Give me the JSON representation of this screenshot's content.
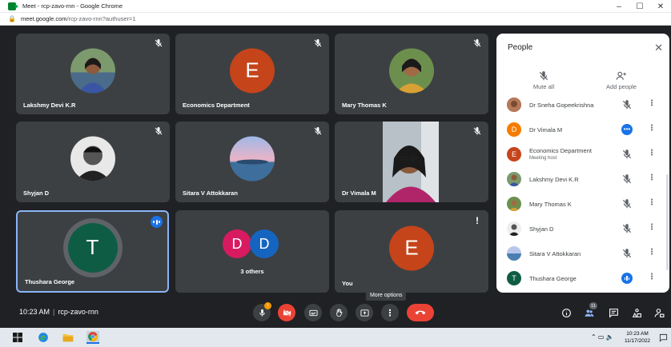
{
  "browser": {
    "window_title": "Meet - rcp-zavo-rnn - Google Chrome",
    "url_host": "meet.google.com",
    "url_path": "/rcp-zavo-rnn?authuser=1",
    "controls": [
      "–",
      "☐",
      "✕"
    ]
  },
  "tiles": [
    {
      "name": "Lakshmy Devi K.R",
      "type": "photo",
      "muted": true
    },
    {
      "name": "Economics Department",
      "type": "letter",
      "letter": "E",
      "color": "#c5441a",
      "muted": true
    },
    {
      "name": "Mary Thomas K",
      "type": "photo",
      "muted": true
    },
    {
      "name": "Shyjan D",
      "type": "photo",
      "muted": true
    },
    {
      "name": "Sitara V Attokkaran",
      "type": "photo",
      "muted": true
    },
    {
      "name": "Dr Vimala M",
      "type": "video",
      "muted": true
    },
    {
      "name": "Thushara George",
      "type": "letter",
      "letter": "T",
      "color": "#0f5c45",
      "speaking": true
    },
    {
      "name": "3 others",
      "type": "group",
      "letters": [
        "D",
        "D"
      ],
      "colors": [
        "#d81b60",
        "#1565c0"
      ]
    },
    {
      "name": "You",
      "type": "letter",
      "letter": "E",
      "color": "#c5441a",
      "warning": "!"
    }
  ],
  "people_panel": {
    "title": "People",
    "mute_all": "Mute all",
    "add_people": "Add people",
    "participants": [
      {
        "name": "Dr Sneha Gopeekrishna",
        "avatar": "photo",
        "status": "muted"
      },
      {
        "name": "Dr Vimala M",
        "avatar": "letter",
        "letter": "D",
        "color": "#f57c00",
        "status": "more"
      },
      {
        "name": "Economics Department",
        "sub": "Meeting host",
        "avatar": "letter",
        "letter": "E",
        "color": "#c5441a",
        "status": "muted"
      },
      {
        "name": "Lakshmy Devi K.R",
        "avatar": "photo",
        "status": "muted"
      },
      {
        "name": "Mary Thomas K",
        "avatar": "photo",
        "status": "muted"
      },
      {
        "name": "Shyjan D",
        "avatar": "photo",
        "status": "muted"
      },
      {
        "name": "Sitara V Attokkaran",
        "avatar": "photo",
        "status": "muted"
      },
      {
        "name": "Thushara George",
        "avatar": "letter",
        "letter": "T",
        "color": "#0f5c45",
        "status": "speaking"
      }
    ]
  },
  "tooltip": "More options",
  "bottom_bar": {
    "time": "10:23 AM",
    "meeting_code": "rcp-zavo-rnn",
    "participant_count": "11"
  },
  "taskbar": {
    "time": "10:23 AM",
    "date": "11/17/2022"
  }
}
